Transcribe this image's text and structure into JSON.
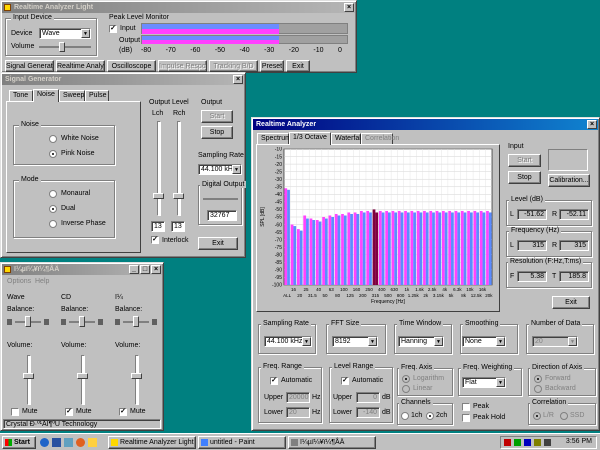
{
  "main": {
    "title": "Realtime Analyzer Light",
    "input_device_group": "Input Device",
    "device_label": "Device",
    "device_value": "Wave",
    "volume_label": "Volume",
    "peak_group": "Peak Level Monitor",
    "input_label": "Input",
    "output_label": "Output",
    "db_label": "(dB)",
    "scale": [
      "-80",
      "-70",
      "-60",
      "-50",
      "-40",
      "-30",
      "-20",
      "-10",
      "0"
    ],
    "input_level": 0.67,
    "output_level": 0.67,
    "buttons": [
      "Signal Generator",
      "Realtime Analyzer",
      "Oscilloscope",
      "Impulse Response",
      "Tracking B/D",
      "Preset",
      "Exit"
    ]
  },
  "siggen": {
    "title": "Signal Generator",
    "tabs": [
      "Tone",
      "Noise",
      "Sweep",
      "Pulse"
    ],
    "noise_group": "Noise",
    "white": "White Noise",
    "pink": "Pink Noise",
    "mode_group": "Mode",
    "monaural": "Monaural",
    "dual": "Dual",
    "inverse": "Inverse Phase",
    "output_level_label": "Output Level",
    "lch": "Lch",
    "rch": "Rch",
    "l_value": "13",
    "r_value": "13",
    "interlock": "Interlock",
    "output_label": "Output",
    "start": "Start",
    "stop": "Stop",
    "sampling_rate_label": "Sampling Rate",
    "sampling_rate": "44.100 kHz",
    "digital_output_label": "Digital Output",
    "digital_value": "32767",
    "exit": "Exit"
  },
  "mixer": {
    "title": "ï¼µï¼¥ï¼¶ÅÄ",
    "menu": [
      "Options",
      "Help"
    ],
    "channels": [
      {
        "name": "Wave"
      },
      {
        "name": "CD"
      },
      {
        "name": "ï¼"
      }
    ],
    "balance_label": "Balance:",
    "volume_label": "Volume:",
    "mute_label": "Mute",
    "status": "Crystal Ð·º¹ÅÏ¶ºÚ Technology"
  },
  "rta": {
    "title": "Realtime Analyzer",
    "tabs": [
      "Spectrum",
      "1/3 Octave",
      "Waterfall",
      "Correlation"
    ],
    "y_ticks": [
      "-10",
      "-15",
      "-20",
      "-25",
      "-30",
      "-35",
      "-40",
      "-45",
      "-50",
      "-55",
      "-60",
      "-65",
      "-70",
      "-75",
      "-80",
      "-85",
      "-90",
      "-95",
      "-100"
    ],
    "ylabel": "SPL [dB]",
    "xlabel": "Frequency [Hz]",
    "x_ticks": [
      "16",
      "25",
      "40",
      "63",
      "100",
      "160",
      "250",
      "400",
      "630",
      "1k",
      "1.6k",
      "2.5k",
      "4k",
      "6.3k",
      "10k",
      "16k"
    ],
    "x_ticks2": [
      "ALL",
      "20",
      "31.5",
      "50",
      "80",
      "125",
      "200",
      "315",
      "500",
      "800",
      "1.25k",
      "2k",
      "3.15k",
      "5k",
      "8k",
      "12.5k",
      "20k"
    ],
    "input_label": "Input",
    "start": "Start",
    "stop": "Stop",
    "calibration": "Calibration...",
    "level_label": "Level (dB)",
    "level_l": "-51.62",
    "level_r": "-52.11",
    "freq_label": "Frequency (Hz)",
    "freq_l": "315",
    "freq_r": "315",
    "res_label": "Resolution (F:Hz,T:ms)",
    "res_f": "5.38",
    "res_t": "185.8",
    "exit": "Exit",
    "sampling_label": "Sampling Rate",
    "sampling_value": "44.100 kHz",
    "fft_label": "FFT Size",
    "fft_value": "8192",
    "tw_label": "Time Window",
    "tw_value": "Hanning",
    "smooth_label": "Smoothing",
    "smooth_value": "None",
    "nd_label": "Number of Data",
    "nd_value": "20",
    "freq_range_label": "Freq. Range",
    "automatic": "Automatic",
    "upper": "Upper",
    "lower": "Lower",
    "fr_upper": "20000",
    "fr_lower": "20",
    "hz": "Hz",
    "level_range_label": "Level Range",
    "lr_upper": "0",
    "lr_lower": "-140",
    "db": "dB",
    "freq_axis_label": "Freq. Axis",
    "logarithm": "Logarithm",
    "linear": "Linear",
    "weighting_label": "Freq. Weighting",
    "weighting_value": "Flat",
    "dir_label": "Direction of Axis",
    "forward": "Forward",
    "backward": "Backward",
    "channels_label": "Channels",
    "ch1": "1ch",
    "ch2": "2ch",
    "peak": "Peak",
    "peak_hold": "Peak Hold",
    "corr_label": "Correlation",
    "corr_lr": "L/R",
    "corr_ssd": "SSD"
  },
  "chart_data": {
    "type": "bar",
    "ylabel": "SPL [dB]",
    "xlabel": "Frequency [Hz]",
    "ylim": [
      -100,
      -10
    ],
    "categories": [
      "ALL",
      "16",
      "20",
      "25",
      "31.5",
      "40",
      "50",
      "63",
      "80",
      "100",
      "125",
      "160",
      "200",
      "250",
      "315",
      "400",
      "500",
      "630",
      "800",
      "1k",
      "1.25k",
      "1.6k",
      "2k",
      "2.5k",
      "3.15k",
      "4k",
      "5k",
      "6.3k",
      "8k",
      "10k",
      "12.5k",
      "16k",
      "20k"
    ],
    "series": [
      {
        "color": "#ff44ff",
        "values": [
          -36,
          -60,
          -63,
          -54,
          -56,
          -57,
          -55,
          -54,
          -53,
          -53,
          -52,
          -52,
          -51,
          -51,
          -50,
          -51,
          -51,
          -51,
          -51,
          -51,
          -51,
          -51,
          -51,
          -51,
          -51,
          -51,
          -51,
          -51,
          -51,
          -51,
          -51,
          -51,
          -51
        ]
      },
      {
        "color": "#5b8cff",
        "values": [
          -37,
          -61,
          -64,
          -56,
          -57,
          -58,
          -56,
          -55,
          -54,
          -54,
          -53,
          -53,
          -52,
          -52,
          -52,
          -52,
          -52,
          -52,
          -52,
          -52,
          -52,
          -52,
          -52,
          -52,
          -52,
          -52,
          -52,
          -52,
          -52,
          -52,
          -52,
          -52,
          -52
        ]
      }
    ],
    "highlight_category": "315",
    "highlight_color": "#800040"
  },
  "taskbar": {
    "start": "Start",
    "items": [
      "Realtime Analyzer Light",
      "untitled - Paint",
      "ï¼µï¼¥ï¼¶ÅÄ"
    ],
    "clock": "3:56 PM"
  },
  "colors": {
    "desktop": "#008080",
    "title_active": "#000080",
    "face": "#c0c0c0"
  }
}
